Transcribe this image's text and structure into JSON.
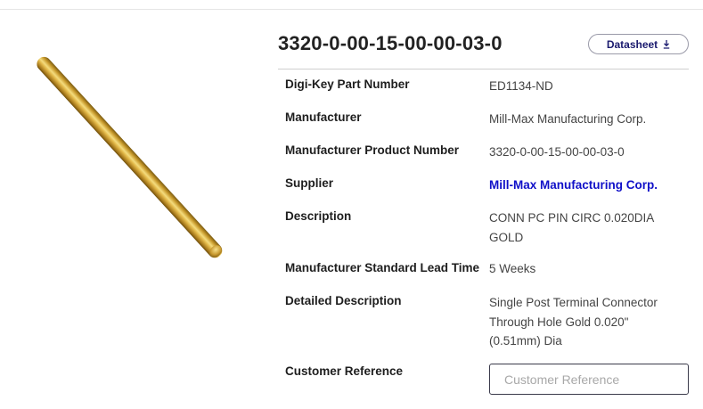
{
  "product": {
    "part_title": "3320-0-00-15-00-00-03-0",
    "datasheet_label": "Datasheet",
    "image_icon": "gold-pin-image"
  },
  "attributes": [
    {
      "label": "Digi-Key Part Number",
      "value": "ED1134-ND"
    },
    {
      "label": "Manufacturer",
      "value": "Mill-Max Manufacturing Corp."
    },
    {
      "label": "Manufacturer Product Number",
      "value": "3320-0-00-15-00-00-03-0"
    },
    {
      "label": "Supplier",
      "value": "Mill-Max Manufacturing Corp."
    },
    {
      "label": "Description",
      "value": "CONN PC PIN CIRC 0.020DIA GOLD"
    },
    {
      "label": "Manufacturer Standard Lead Time",
      "value": "5 Weeks"
    },
    {
      "label": "Detailed Description",
      "value": "Single Post Terminal Connector Through Hole Gold 0.020\" (0.51mm) Dia"
    }
  ],
  "customer_reference": {
    "label": "Customer Reference",
    "placeholder": "Customer Reference"
  },
  "colors": {
    "link": "#1010c8",
    "button_text": "#1a1a6e"
  }
}
